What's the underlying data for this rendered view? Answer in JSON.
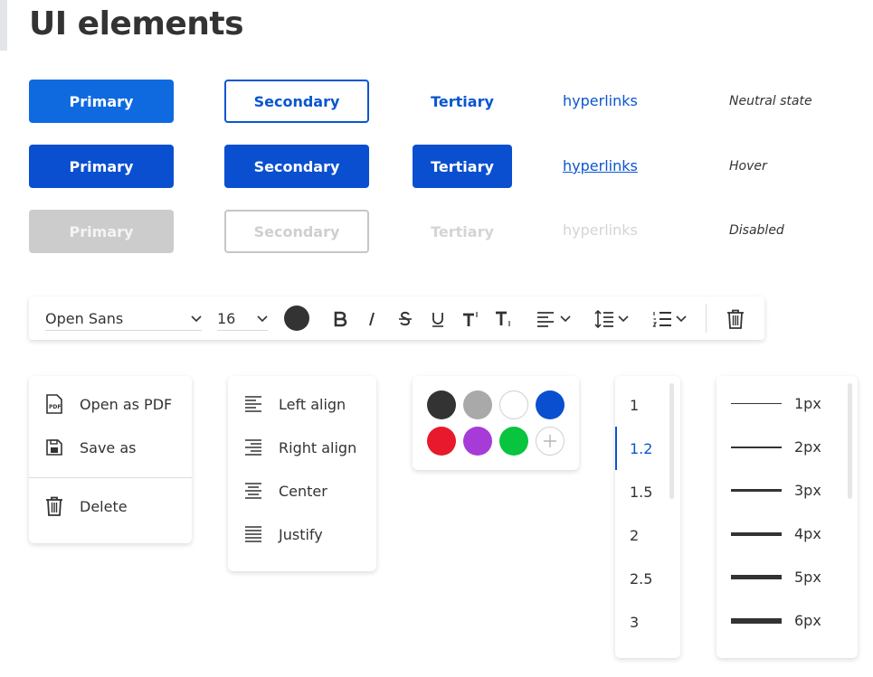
{
  "page_title": "UI elements",
  "buttons": {
    "primary": "Primary",
    "secondary": "Secondary",
    "tertiary": "Tertiary",
    "hyperlinks": "hyperlinks"
  },
  "states": {
    "neutral": "Neutral state",
    "hover": "Hover",
    "disabled": "Disabled"
  },
  "toolbar": {
    "font_family": "Open Sans",
    "font_size": "16",
    "text_color": "#333333"
  },
  "file_menu": {
    "open_pdf": "Open as PDF",
    "save_as": "Save as",
    "delete": "Delete"
  },
  "align_menu": {
    "left": "Left align",
    "right": "Right align",
    "center": "Center",
    "justify": "Justify"
  },
  "colors": [
    "#333333",
    "#a9a9a9",
    "#ffffff",
    "#0a4fcf",
    "#e8192c",
    "#a63bd8",
    "#08c43e"
  ],
  "line_spacing": {
    "options": [
      "1",
      "1.2",
      "1.5",
      "2",
      "2.5",
      "3"
    ],
    "selected": "1.2"
  },
  "stroke_widths": [
    "1px",
    "2px",
    "3px",
    "4px",
    "5px",
    "6px"
  ],
  "accent_color": "#0a56d0"
}
